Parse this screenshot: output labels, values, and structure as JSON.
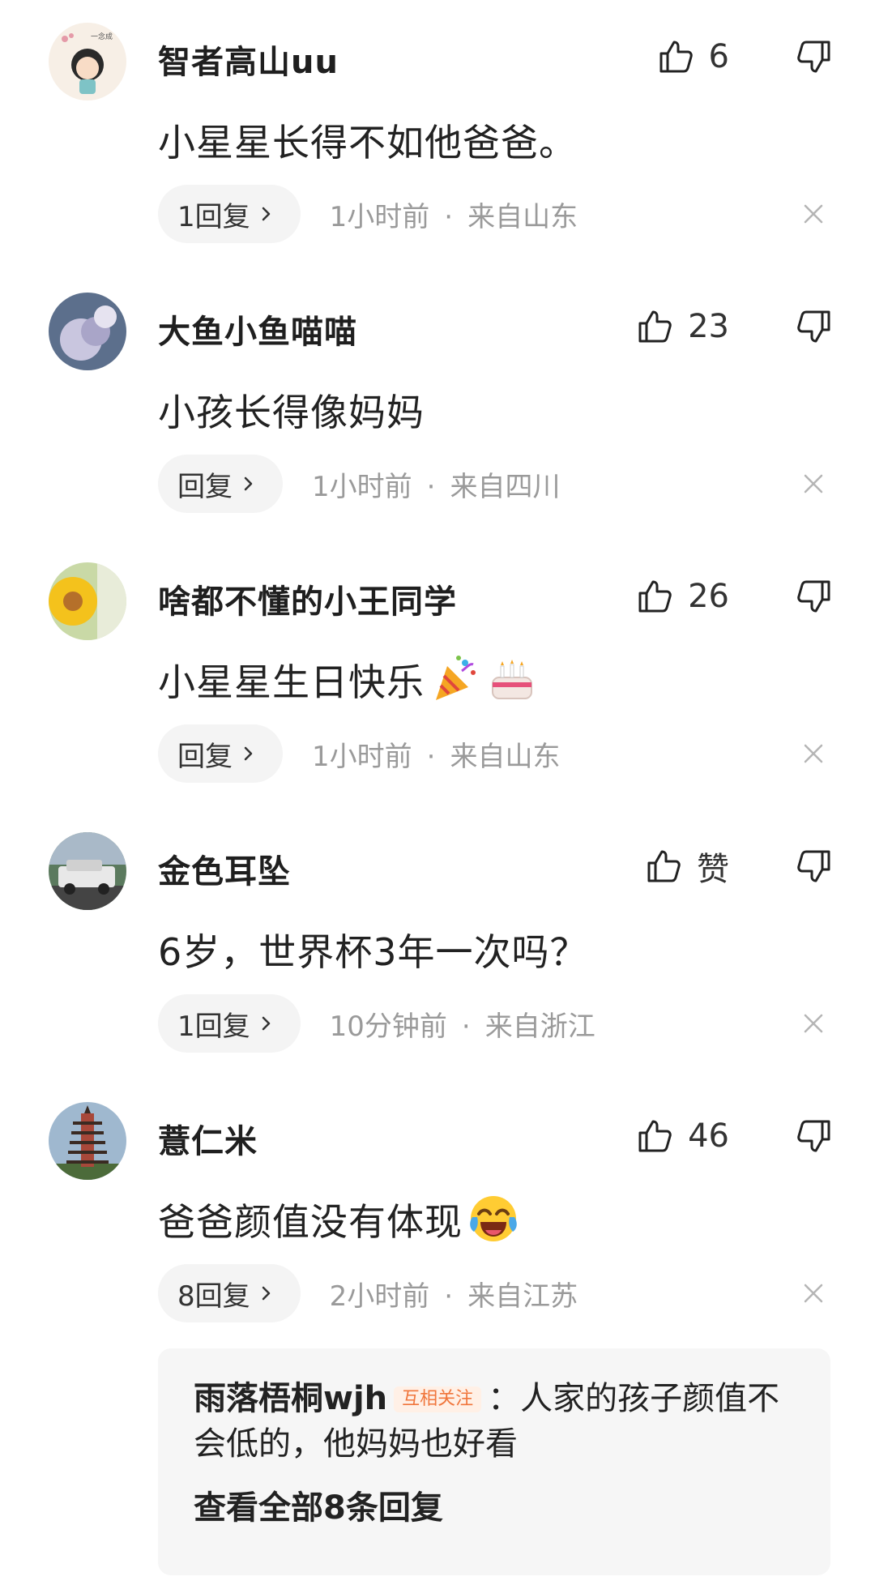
{
  "comments": [
    {
      "username": "智者高山uu",
      "like_count": "6",
      "content": "小星星长得不如他爸爸。",
      "reply_label": "1回复",
      "time": "1小时前",
      "location": "来自山东",
      "avatar": "cartoon-girl-avatar"
    },
    {
      "username": "大鱼小鱼喵喵",
      "like_count": "23",
      "content": "小孩长得像妈妈",
      "reply_label": "回复",
      "time": "1小时前",
      "location": "来自四川",
      "avatar": "flower-photo-avatar"
    },
    {
      "username": "啥都不懂的小王同学",
      "like_count": "26",
      "content": "小星星生日快乐",
      "emojis": [
        "party-popper-emoji",
        "birthday-cake-emoji"
      ],
      "reply_label": "回复",
      "time": "1小时前",
      "location": "来自山东",
      "avatar": "sunflower-avatar"
    },
    {
      "username": "金色耳坠",
      "like_count": "赞",
      "content": "6岁，世界杯3年一次吗？",
      "reply_label": "1回复",
      "time": "10分钟前",
      "location": "来自浙江",
      "avatar": "car-photo-avatar"
    },
    {
      "username": "薏仁米",
      "like_count": "46",
      "content": "爸爸颜值没有体现",
      "emojis": [
        "crying-laughing-emoji"
      ],
      "reply_label": "8回复",
      "time": "2小时前",
      "location": "来自江苏",
      "avatar": "pagoda-avatar"
    }
  ],
  "reply_preview": {
    "username": "雨落梧桐wjh",
    "badge": "互相关注",
    "separator": "：",
    "text": "人家的孩子颜值不会低的，他妈妈也好看",
    "view_all": "查看全部8条回复"
  },
  "separator_dot": "·",
  "colors": {
    "background": "#ffffff",
    "meta_text": "#9a9a9a",
    "pill_bg": "#f4f4f4",
    "badge_text": "#f0763c"
  }
}
